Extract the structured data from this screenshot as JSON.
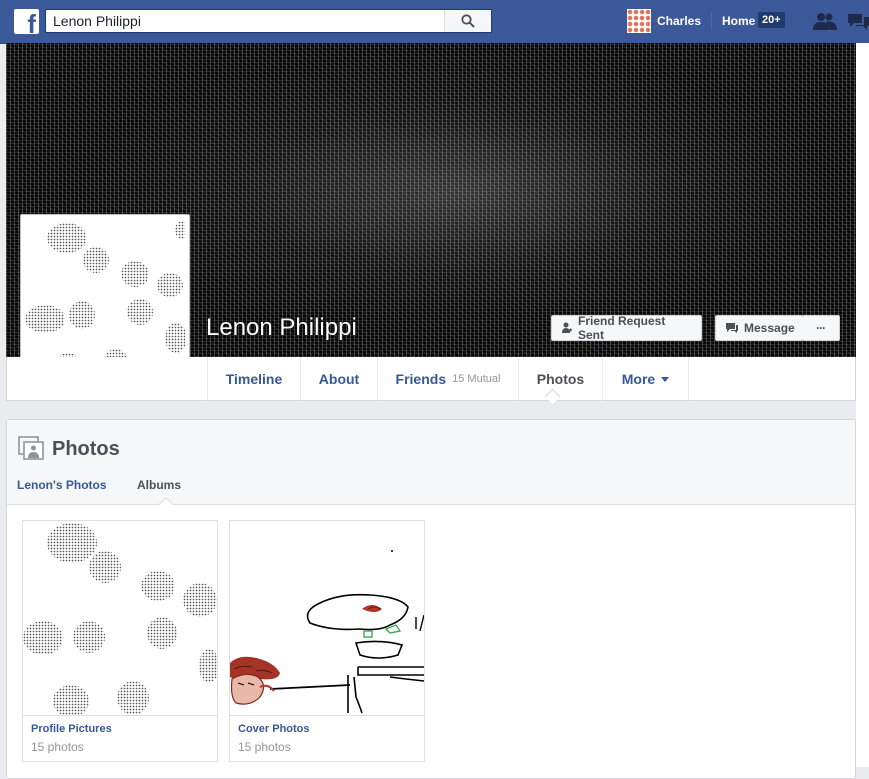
{
  "topbar": {
    "search_value": "Lenon Philippi",
    "user_name": "Charles",
    "home_label": "Home",
    "home_badge": "20+"
  },
  "profile": {
    "name": "Lenon Philippi",
    "friend_request_label": "Friend Request Sent",
    "message_label": "Message",
    "more_label": "···"
  },
  "tabs": {
    "timeline": "Timeline",
    "about": "About",
    "friends": "Friends",
    "mutual": "15 Mutual",
    "photos": "Photos",
    "more": "More"
  },
  "photos_section": {
    "title": "Photos",
    "subtabs": [
      "Lenon's Photos",
      "Albums"
    ],
    "albums": [
      {
        "title": "Profile Pictures",
        "count": "15 photos"
      },
      {
        "title": "Cover Photos",
        "count": "15 photos"
      }
    ]
  },
  "colors": {
    "brand": "#3b5998",
    "link": "#365899",
    "page_bg": "#e9ebee"
  }
}
